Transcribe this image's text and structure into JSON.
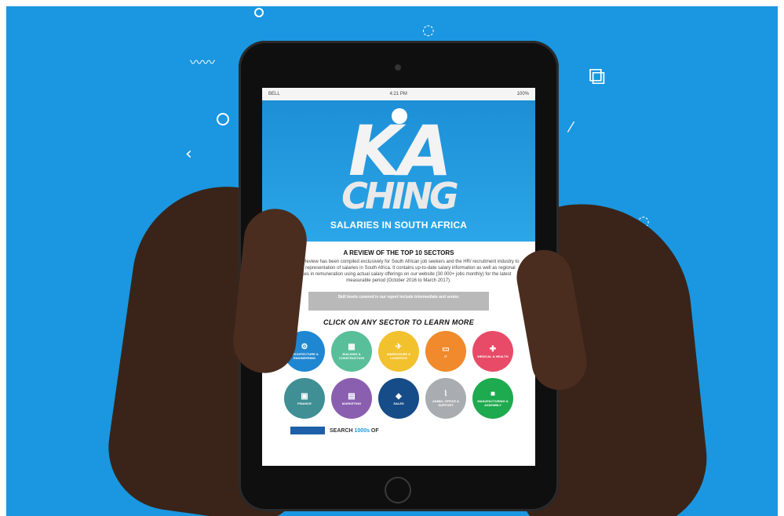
{
  "status_bar": {
    "carrier": "BELL",
    "time": "4:21 PM",
    "battery": "100%"
  },
  "hero": {
    "title_line1": "KA",
    "title_line2": "CHING",
    "subtitle": "SALARIES IN SOUTH AFRICA"
  },
  "review": {
    "heading": "A REVIEW OF THE TOP 10 SECTORS",
    "body": "This Salary Review has been compiled exclusively for South African job seekers and the HR/ recruitment industry to give a true representation of salaries in South Africa. It contains up-to-date salary information as well as regional differences in remuneration using actual salary offerings on our website (30 000+ jobs monthly) for the latest measurable period (October 2016 to March 2017)."
  },
  "notice": {
    "text": "Skill levels covered in our report include intermediate and senior."
  },
  "cta": "CLICK ON ANY SECTOR TO LEARN MORE",
  "sectors": [
    {
      "label": "ARCHITECTURE & ENGINEERING",
      "icon": "gear-icon",
      "glyph": "⚙",
      "color": "#1f86d1"
    },
    {
      "label": "BUILDING & CONSTRUCTION",
      "icon": "building-icon",
      "glyph": "▦",
      "color": "#59bf9a"
    },
    {
      "label": "WAREHOUSE & LOGISTICS",
      "icon": "plane-icon",
      "glyph": "✈",
      "color": "#f2c12e"
    },
    {
      "label": "IT",
      "icon": "laptop-icon",
      "glyph": "▭",
      "color": "#f08a2c"
    },
    {
      "label": "MEDICAL & HEALTH",
      "icon": "medical-bag-icon",
      "glyph": "✚",
      "color": "#e84b67"
    },
    {
      "label": "FINANCE",
      "icon": "money-icon",
      "glyph": "▣",
      "color": "#3f8f95"
    },
    {
      "label": "MARKETING",
      "icon": "billboard-icon",
      "glyph": "▤",
      "color": "#8a5fb0"
    },
    {
      "label": "SALES",
      "icon": "tag-icon",
      "glyph": "◆",
      "color": "#164c87"
    },
    {
      "label": "ADMIN, OFFICE & SUPPORT",
      "icon": "paperclip-icon",
      "glyph": "⌇",
      "color": "#a9adb2"
    },
    {
      "label": "MANUFACTURING & ASSEMBLY",
      "icon": "bus-icon",
      "glyph": "■",
      "color": "#1eaa4e"
    }
  ],
  "search": {
    "prefix": "SEARCH ",
    "highlight": "1000s",
    "suffix": " OF"
  },
  "colors": {
    "background": "#1a97e0",
    "skin": "#3a2419",
    "device": "#0f0f10"
  }
}
